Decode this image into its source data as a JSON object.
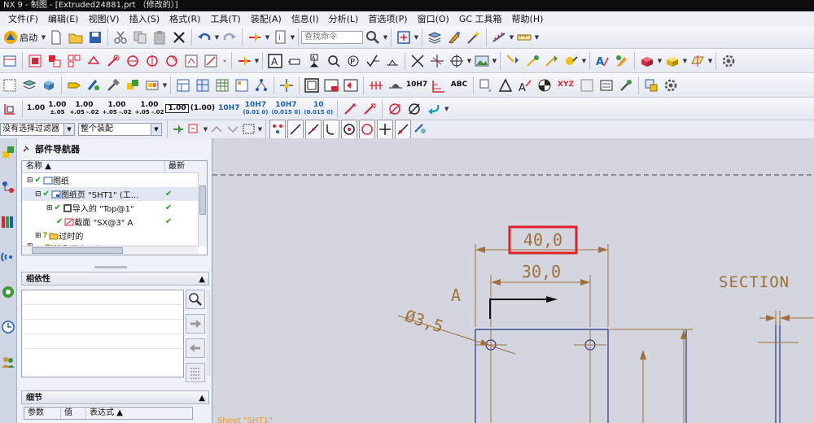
{
  "window": {
    "title": "NX 9 - 制图 - [Extruded24881.prt （修改的）]"
  },
  "menu": [
    "文件(F)",
    "编辑(E)",
    "视图(V)",
    "插入(S)",
    "格式(R)",
    "工具(T)",
    "装配(A)",
    "信息(I)",
    "分析(L)",
    "首选项(P)",
    "窗口(O)",
    "GC 工具箱",
    "帮助(H)"
  ],
  "toolbar1": {
    "start_label": "启动",
    "search_placeholder": "查找命令"
  },
  "toolbar4": {
    "tolerance_buttons": [
      {
        "main": "1.00",
        "sub": ""
      },
      {
        "main": "1.00",
        "sub": "±.05"
      },
      {
        "main": "1.00",
        "sub": "+.05 -.02"
      },
      {
        "main": "1.00",
        "sub": "+.05 -.02"
      },
      {
        "main": "1.00",
        "sub": "+.05 -.02"
      },
      {
        "main": "1.00",
        "sub": ""
      },
      {
        "main": "(1.00)",
        "sub": ""
      },
      {
        "main": "10H7",
        "sub": ""
      },
      {
        "main": "10H7",
        "sub": "(0.01 0)"
      },
      {
        "main": "10H7",
        "sub": "(0.015 0)"
      },
      {
        "main": "10",
        "sub": "(0.015 0)"
      }
    ]
  },
  "toolbar3": {
    "tol_label": "10H7",
    "abc_label": "ABC",
    "xyz_label": "XYZ"
  },
  "filterbar": {
    "filter_value": "没有选择过滤器",
    "scope_value": "整个装配"
  },
  "part_navigator": {
    "title": "部件导航器",
    "columns": [
      "名称",
      "最新"
    ],
    "rows": [
      {
        "label": "图纸",
        "level": 0
      },
      {
        "label": "图纸页 \"SHT1\" (工...",
        "level": 1
      },
      {
        "label": "导入的 \"Top@1\"",
        "level": 2
      },
      {
        "label": "截面 \"SX@3\" A",
        "level": 2
      },
      {
        "label": "过时的",
        "level": 1
      },
      {
        "label": "模型历史记录",
        "level": 0
      }
    ],
    "dependency_title": "相依性",
    "details_title": "细节",
    "details_columns": [
      "参数",
      "值",
      "表达式"
    ]
  },
  "drawing": {
    "dim_outer": "40,0",
    "dim_inner": "30,0",
    "dim_diameter": "Ø3,5",
    "section_label": "A",
    "section_view_title": "SECTION",
    "sheet_label": "Sheet \"SHT1\""
  },
  "colors": {
    "highlight_box": "#e0202a",
    "dimension": "#a0703a",
    "geometry": "#27328a",
    "check": "#1c9b1c"
  }
}
